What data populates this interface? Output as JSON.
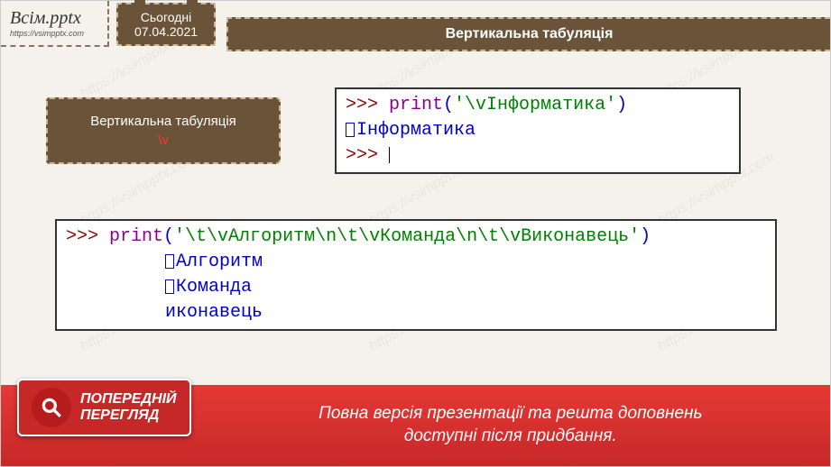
{
  "logo": {
    "title": "Всім.pptx",
    "url": "https://vsimpptx.com"
  },
  "date_badge": {
    "label": "Сьогодні",
    "date": "07.04.2021"
  },
  "slide_title": "Вертикальна табуляція",
  "definition_box": {
    "label": "Вертикальна табуляція",
    "escape": "\\v"
  },
  "code1": {
    "prompt": ">>> ",
    "call": "print",
    "paren_open": "(",
    "string": "'\\vІнформатика'",
    "paren_close": ")",
    "output": "Інформатика",
    "prompt2": ">>> "
  },
  "code2": {
    "prompt": ">>> ",
    "call": "print",
    "paren_open": "(",
    "string": "'\\t\\vАлгоритм\\n\\t\\vКоманда\\n\\t\\vВиконавець'",
    "paren_close": ")",
    "out1": "Алгоритм",
    "out2": "Команда",
    "out3": "иконавець"
  },
  "banner": {
    "badge_line1": "ПОПЕРЕДНІЙ",
    "badge_line2": "ПЕРЕГЛЯД",
    "message_line1": "Повна версія презентації та решта доповнень",
    "message_line2": "доступні після придбання."
  },
  "watermark_text": "https://vsimpptx.com"
}
